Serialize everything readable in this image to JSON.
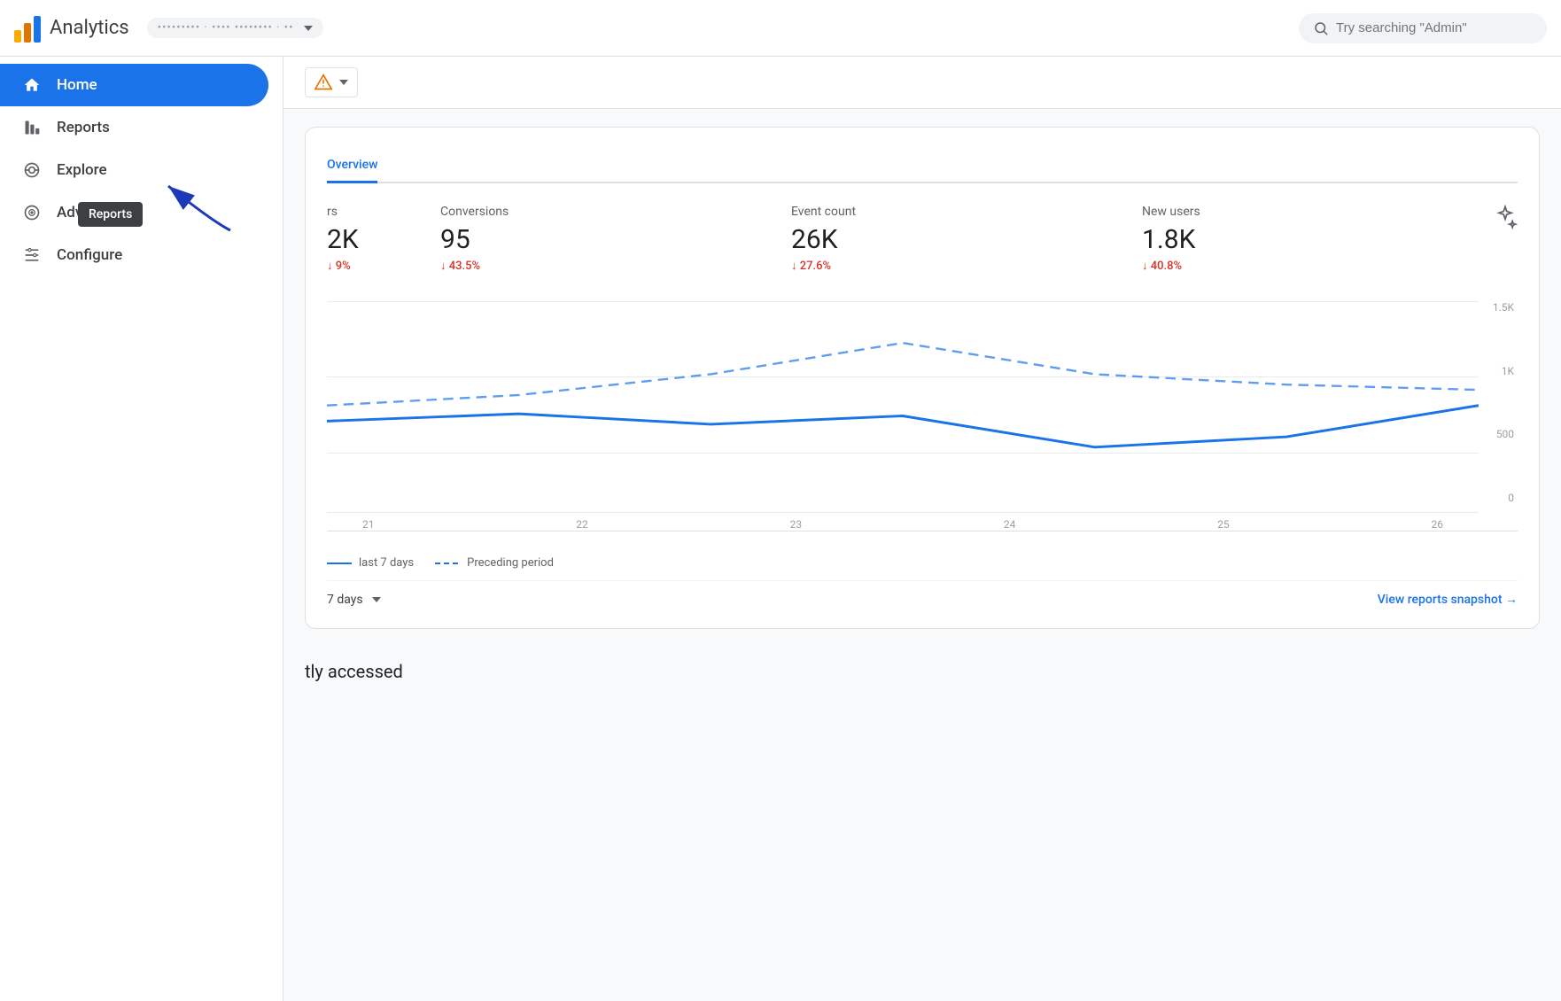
{
  "header": {
    "title": "Analytics",
    "account_placeholder": "••••••••• · •••• •••••••• · ••",
    "search_placeholder": "Try searching \"Admin\""
  },
  "sidebar": {
    "items": [
      {
        "id": "home",
        "label": "Home",
        "active": true
      },
      {
        "id": "reports",
        "label": "Reports",
        "active": false
      },
      {
        "id": "explore",
        "label": "Explore",
        "active": false
      },
      {
        "id": "advertising",
        "label": "Advertising",
        "active": false
      },
      {
        "id": "configure",
        "label": "Configure",
        "active": false
      }
    ]
  },
  "tooltip": {
    "reports_label": "Reports"
  },
  "dashboard": {
    "tab_label": "Overview",
    "metrics": [
      {
        "label": "Conversions",
        "value": "95",
        "change": "↓ 43.5%",
        "negative": true
      },
      {
        "label": "Event count",
        "value": "26K",
        "change": "↓ 27.6%",
        "negative": true
      },
      {
        "label": "New users",
        "value": "1.8K",
        "change": "↓ 40.8%",
        "negative": true
      }
    ],
    "partial_metric": {
      "value": "2K",
      "change": "9%"
    },
    "chart": {
      "y_labels": [
        "1.5K",
        "1K",
        "500",
        "0"
      ],
      "x_labels": [
        "21",
        "22",
        "23",
        "24",
        "25",
        "26"
      ]
    },
    "legend": {
      "solid_label": "last 7 days",
      "dashed_label": "Preceding period"
    },
    "period_label": "7 days",
    "view_reports_label": "View reports snapshot →"
  },
  "recently": {
    "title": "tly accessed"
  }
}
